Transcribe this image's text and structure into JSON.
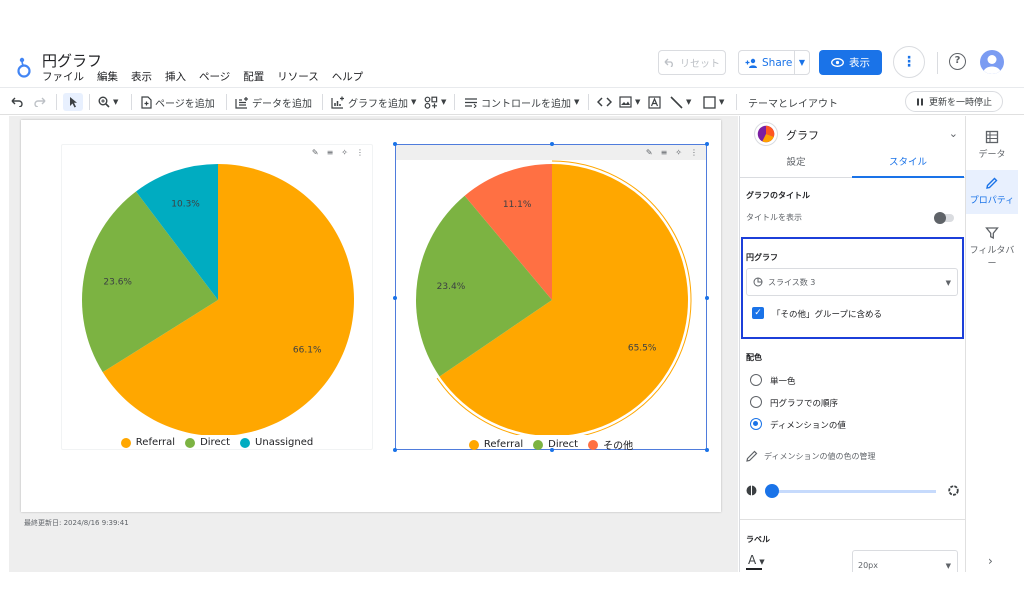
{
  "header": {
    "title": "円グラフ",
    "menu": [
      "ファイル",
      "編集",
      "表示",
      "挿入",
      "ページ",
      "配置",
      "リソース",
      "ヘルプ"
    ],
    "reset_label": "リセット",
    "share_label": "Share",
    "view_label": "表示",
    "accent_color": "#1a73e8"
  },
  "toolbar": {
    "add_page": "ページを追加",
    "add_data": "データを追加",
    "add_chart": "グラフを追加",
    "add_control": "コントロールを追加",
    "theme_layout": "テーマとレイアウト",
    "pause_update": "更新を一時停止"
  },
  "canvas": {
    "last_updated": "最終更新日: 2024/8/16 9:39:41"
  },
  "chart_data": [
    {
      "type": "pie",
      "categories": [
        "Referral",
        "Direct",
        "Unassigned"
      ],
      "values": [
        66.1,
        23.6,
        10.3
      ],
      "labels": [
        "66.1%",
        "23.6%",
        "10.3%"
      ],
      "colors": [
        "#FFA700",
        "#7CB342",
        "#00ACC1"
      ],
      "legend": "bottom"
    },
    {
      "type": "pie",
      "categories": [
        "Referral",
        "Direct",
        "その他"
      ],
      "values": [
        65.5,
        23.4,
        11.1
      ],
      "labels": [
        "65.5%",
        "23.4%",
        "11.1%"
      ],
      "colors": [
        "#FFA700",
        "#7CB342",
        "#FF7043"
      ],
      "legend": "bottom"
    }
  ],
  "panel": {
    "chart_type": "グラフ",
    "tab_setup": "設定",
    "tab_style": "スタイル",
    "title_section": "グラフのタイトル",
    "show_title": "タイトルを表示",
    "pie_section": "円グラフ",
    "slice_count": "スライス数 3",
    "include_other": "「その他」グループに含める",
    "color_section": "配色",
    "color_options": [
      "単一色",
      "円グラフでの順序",
      "ディメンションの値"
    ],
    "selected_color_option": "ディメンションの値",
    "color_manage": "ディメンションの値の色の管理",
    "label_section": "ラベル",
    "font_size": "20px"
  },
  "rail": {
    "data": "データ",
    "properties": "プロパティ",
    "filter": "フィルタバー"
  }
}
